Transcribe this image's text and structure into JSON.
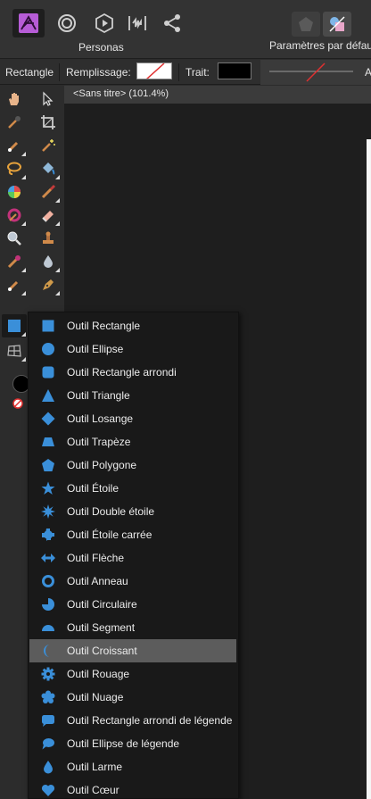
{
  "colors": {
    "accent": "#3a8fd9",
    "persona_purple": "#b65cd6",
    "highlight": "#5c5c5c"
  },
  "topbar": {
    "personas_label": "Personas",
    "params_label": "Paramètres par défaut",
    "personas": [
      {
        "icon": "affinity-photo-persona-icon"
      },
      {
        "icon": "liquify-persona-icon"
      },
      {
        "icon": "develop-persona-icon"
      },
      {
        "icon": "tone-mapping-persona-icon"
      },
      {
        "icon": "export-persona-icon"
      }
    ]
  },
  "context": {
    "tool_name": "Rectangle",
    "fill_label": "Remplissage:",
    "stroke_label": "Trait:",
    "truncated": "A"
  },
  "document": {
    "title": "<Sans titre> (101.4%)"
  },
  "menu": {
    "items": [
      {
        "label": "Outil Rectangle",
        "icon": "rectangle-icon"
      },
      {
        "label": "Outil Ellipse",
        "icon": "ellipse-icon"
      },
      {
        "label": "Outil Rectangle arrondi",
        "icon": "rounded-rectangle-icon"
      },
      {
        "label": "Outil Triangle",
        "icon": "triangle-icon"
      },
      {
        "label": "Outil Losange",
        "icon": "diamond-icon"
      },
      {
        "label": "Outil Trapèze",
        "icon": "trapezoid-icon"
      },
      {
        "label": "Outil Polygone",
        "icon": "polygon-icon"
      },
      {
        "label": "Outil Étoile",
        "icon": "star-icon"
      },
      {
        "label": "Outil Double étoile",
        "icon": "double-star-icon"
      },
      {
        "label": "Outil Étoile carrée",
        "icon": "square-star-icon"
      },
      {
        "label": "Outil Flèche",
        "icon": "arrow-icon"
      },
      {
        "label": "Outil Anneau",
        "icon": "donut-icon"
      },
      {
        "label": "Outil Circulaire",
        "icon": "pie-icon"
      },
      {
        "label": "Outil Segment",
        "icon": "segment-icon"
      },
      {
        "label": "Outil Croissant",
        "icon": "crescent-icon",
        "highlighted": true
      },
      {
        "label": "Outil Rouage",
        "icon": "cog-icon"
      },
      {
        "label": "Outil Nuage",
        "icon": "cloud-icon"
      },
      {
        "label": "Outil Rectangle arrondi de légende",
        "icon": "callout-rounded-rectangle-icon"
      },
      {
        "label": "Outil Ellipse de légende",
        "icon": "callout-ellipse-icon"
      },
      {
        "label": "Outil Larme",
        "icon": "tear-icon"
      },
      {
        "label": "Outil Cœur",
        "icon": "heart-icon"
      }
    ]
  }
}
